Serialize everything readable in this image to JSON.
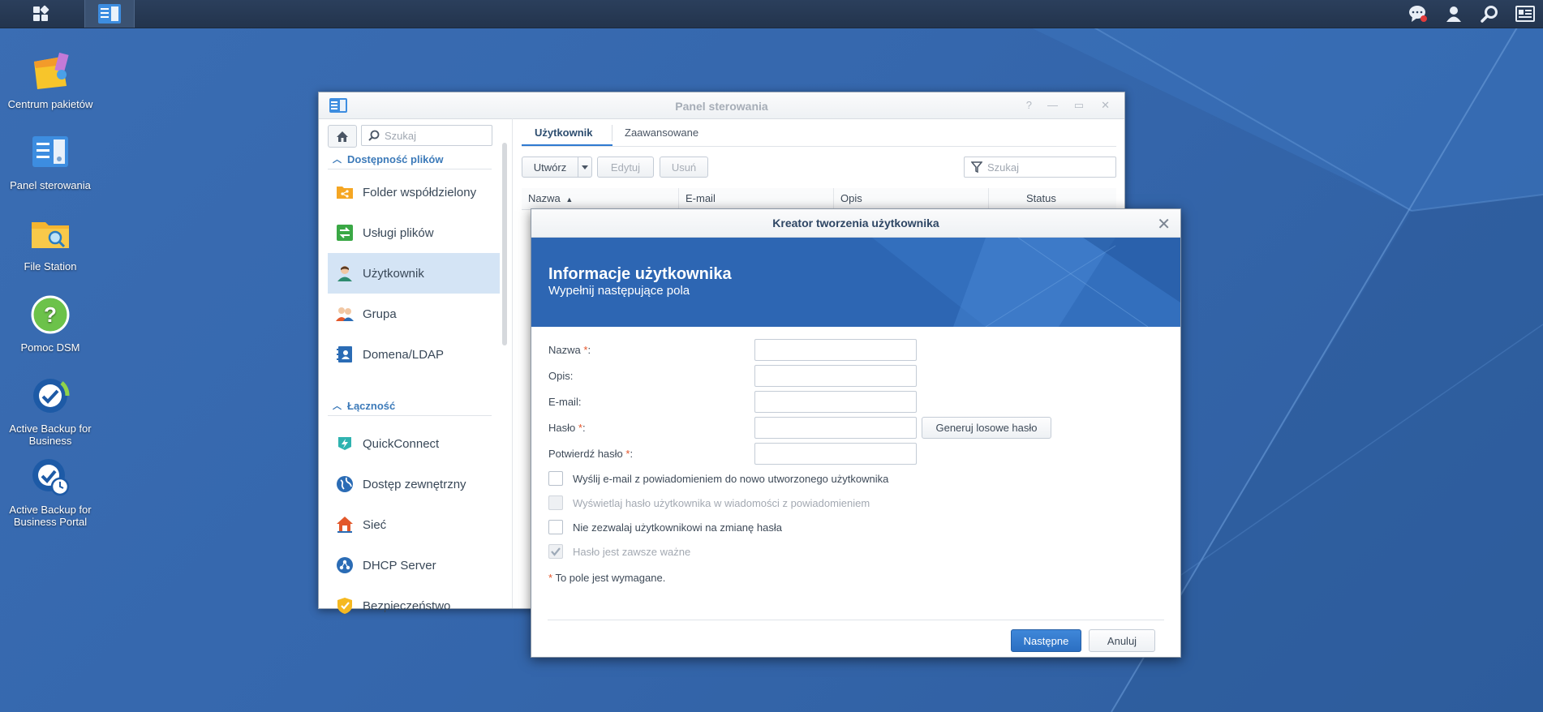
{
  "taskbar": {
    "main_menu_icon": "grid-icon",
    "active_app_icon": "control-panel-icon",
    "right_icons": [
      "notification-icon",
      "user-icon",
      "search-icon",
      "widgets-icon"
    ]
  },
  "desktop": {
    "icons": [
      {
        "label": "Centrum pakietów",
        "icon": "package-center-icon"
      },
      {
        "label": "Panel sterowania",
        "icon": "control-panel-icon"
      },
      {
        "label": "File Station",
        "icon": "folder-search-icon"
      },
      {
        "label": "Pomoc DSM",
        "icon": "help-icon"
      },
      {
        "label": "Active Backup for Business",
        "icon": "backup-icon"
      },
      {
        "label": "Active Backup for Business Portal",
        "icon": "backup-portal-icon"
      }
    ]
  },
  "control_panel": {
    "title": "Panel sterowania",
    "sidebar": {
      "search_placeholder": "Szukaj",
      "sections": [
        {
          "label": "Dostępność plików",
          "items": [
            {
              "label": "Folder współdzielony",
              "icon": "shared-folder-icon",
              "color": "#f5a623"
            },
            {
              "label": "Usługi plików",
              "icon": "file-services-icon",
              "color": "#3aa845"
            },
            {
              "label": "Użytkownik",
              "icon": "user-icon",
              "color": "#2e8b6f",
              "selected": true
            },
            {
              "label": "Grupa",
              "icon": "group-icon",
              "color": "#e2582b"
            },
            {
              "label": "Domena/LDAP",
              "icon": "domain-icon",
              "color": "#2b6cb5"
            }
          ]
        },
        {
          "label": "Łączność",
          "items": [
            {
              "label": "QuickConnect",
              "icon": "quickconnect-icon",
              "color": "#2fb3b0"
            },
            {
              "label": "Dostęp zewnętrzny",
              "icon": "external-access-icon",
              "color": "#2b6cb5"
            },
            {
              "label": "Sieć",
              "icon": "network-icon",
              "color": "#e2582b"
            },
            {
              "label": "DHCP Server",
              "icon": "dhcp-icon",
              "color": "#2b6cb5"
            },
            {
              "label": "Bezpieczeństwo",
              "icon": "security-icon",
              "color": "#f5b820"
            }
          ]
        }
      ]
    },
    "tabs": [
      "Użytkownik",
      "Zaawansowane"
    ],
    "toolbar": {
      "create": "Utwórz",
      "edit": "Edytuj",
      "delete": "Usuń",
      "search_placeholder": "Szukaj"
    },
    "columns": [
      "Nazwa",
      "E-mail",
      "Opis",
      "Status"
    ]
  },
  "wizard": {
    "title": "Kreator tworzenia użytkownika",
    "heading": "Informacje użytkownika",
    "subheading": "Wypełnij następujące pola",
    "fields": [
      {
        "label": "Nazwa",
        "required": true
      },
      {
        "label": "Opis",
        "required": false
      },
      {
        "label": "E-mail",
        "required": false
      },
      {
        "label": "Hasło",
        "required": true
      },
      {
        "label": "Potwierdź hasło",
        "required": true
      }
    ],
    "generate_password": "Generuj losowe hasło",
    "checkboxes": [
      {
        "label": "Wyślij e-mail z powiadomieniem do nowo utworzonego użytkownika",
        "checked": false,
        "disabled": false
      },
      {
        "label": "Wyświetlaj hasło użytkownika w wiadomości z powiadomieniem",
        "checked": false,
        "disabled": true
      },
      {
        "label": "Nie zezwalaj użytkownikowi na zmianę hasła",
        "checked": false,
        "disabled": false
      },
      {
        "label": "Hasło jest zawsze ważne",
        "checked": true,
        "disabled": true
      }
    ],
    "required_note": "To pole jest wymagane.",
    "next": "Następne",
    "cancel": "Anuluj"
  }
}
